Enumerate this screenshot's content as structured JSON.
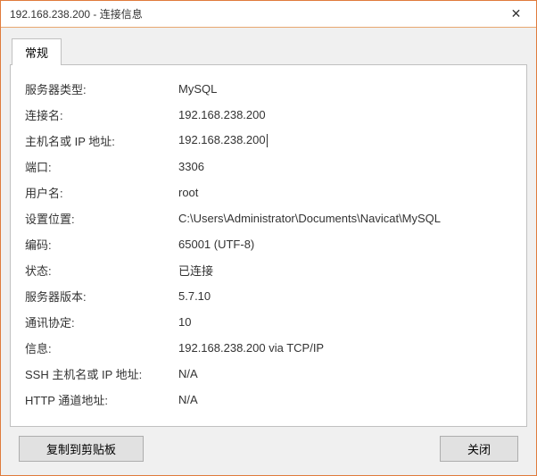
{
  "titlebar": {
    "title": "192.168.238.200 - 连接信息",
    "close": "✕"
  },
  "tab": {
    "label": "常规"
  },
  "fields": {
    "server_type": {
      "label": "服务器类型:",
      "value": "MySQL"
    },
    "conn_name": {
      "label": "连接名:",
      "value": "192.168.238.200"
    },
    "host": {
      "label": "主机名或 IP 地址:",
      "value": "192.168.238.200"
    },
    "port": {
      "label": "端口:",
      "value": "3306"
    },
    "user": {
      "label": "用户名:",
      "value": "root"
    },
    "settings_path": {
      "label": "设置位置:",
      "value": "C:\\Users\\Administrator\\Documents\\Navicat\\MySQL"
    },
    "encoding": {
      "label": "编码:",
      "value": "65001 (UTF-8)"
    },
    "status": {
      "label": "状态:",
      "value": "已连接"
    },
    "server_version": {
      "label": "服务器版本:",
      "value": "5.7.10"
    },
    "protocol": {
      "label": "通讯协定:",
      "value": "10"
    },
    "info": {
      "label": "信息:",
      "value": "192.168.238.200 via TCP/IP"
    },
    "ssh_host": {
      "label": "SSH 主机名或 IP 地址:",
      "value": "N/A"
    },
    "http_tunnel": {
      "label": "HTTP 通道地址:",
      "value": "N/A"
    }
  },
  "buttons": {
    "copy": "复制到剪贴板",
    "close": "关闭"
  }
}
